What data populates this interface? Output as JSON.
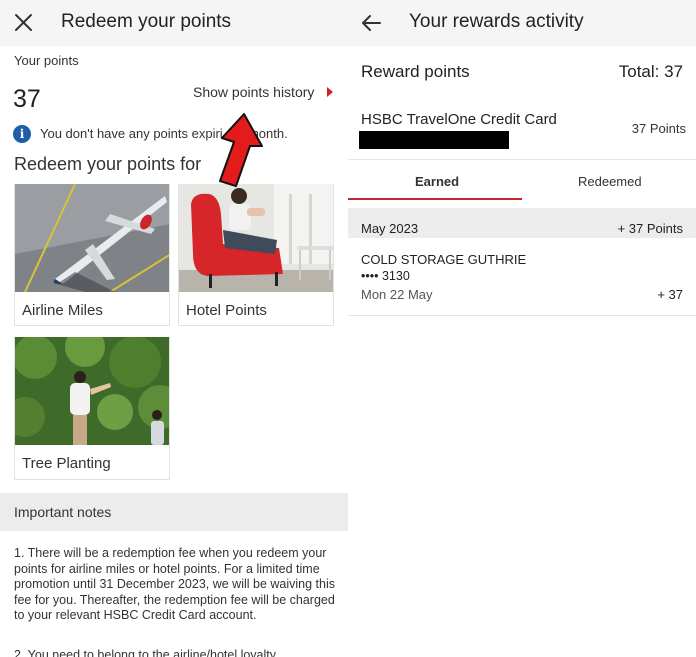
{
  "left_panel": {
    "title": "Redeem your points",
    "your_points_label": "Your points",
    "points_value": "37",
    "history_link": "Show points history",
    "notice_text": "You don't have any points expiri       month.",
    "redeem_heading": "Redeem your points for",
    "options": [
      {
        "label": "Airline Miles"
      },
      {
        "label": "Hotel Points"
      },
      {
        "label": "Tree Planting"
      }
    ],
    "important_notes": {
      "title": "Important notes",
      "note1": "1. There will be a redemption fee when you redeem your points for airline miles or hotel points. For a limited time promotion until 31 December 2023, we will be waiving this fee for you. Thereafter, the redemption fee will be charged to your relevant HSBC Credit Card account.",
      "note2": "2. You need to belong to the airline/hotel loyalty"
    }
  },
  "right_panel": {
    "title": "Your rewards activity",
    "reward_points_heading": "Reward points",
    "total": "Total: 37",
    "card_name": "HSBC TravelOne Credit Card",
    "card_points": "37 Points",
    "tabs": [
      {
        "label": "Earned",
        "active": true
      },
      {
        "label": "Redeemed",
        "active": false
      }
    ],
    "month_group": {
      "label": "May 2023",
      "points": "+ 37 Points"
    },
    "transactions": [
      {
        "merchant": "COLD STORAGE GUTHRIE",
        "card": "•••• 3130",
        "date": "Mon 22 May",
        "points": "+ 37"
      }
    ]
  },
  "colors": {
    "accent_red": "#d81e1e",
    "tab_underline": "#c8262b",
    "info_blue": "#1f5ea8",
    "bar_grey": "#ececec"
  },
  "icons": [
    "close-icon",
    "back-arrow-icon",
    "info-icon",
    "chevron-right-icon",
    "annotation-arrow-icon"
  ]
}
